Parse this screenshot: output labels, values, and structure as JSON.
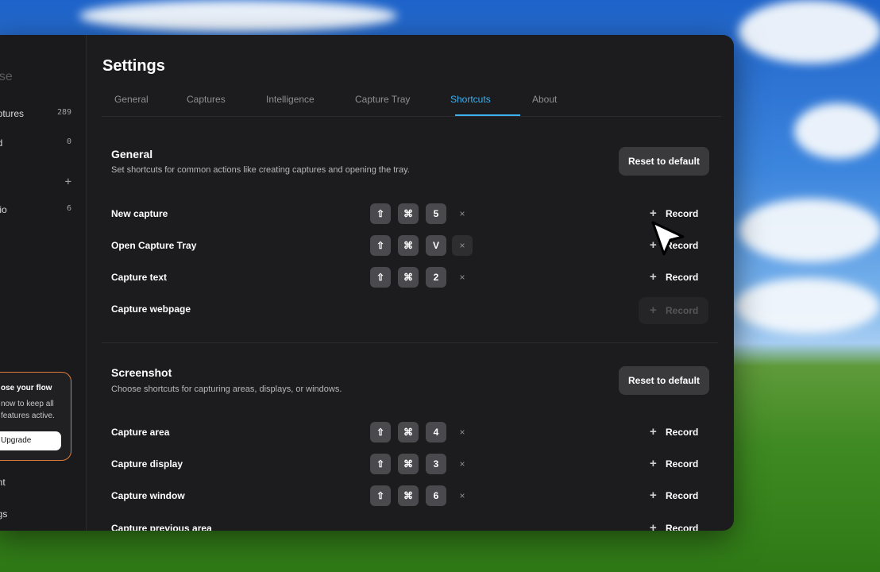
{
  "sidebar": {
    "title": "ase",
    "items": [
      {
        "label": "aptures",
        "count": "289"
      },
      {
        "label": "ed",
        "count": "0"
      },
      {
        "label": "",
        "count": "+"
      },
      {
        "label": "olio",
        "count": "6"
      }
    ],
    "promo": {
      "title": "ose your flow",
      "desc": "now to keep all features active.",
      "button": "Upgrade"
    },
    "bottom": [
      "unt",
      "ngs"
    ]
  },
  "settings": {
    "title": "Settings",
    "tabs": [
      "General",
      "Captures",
      "Intelligence",
      "Capture Tray",
      "Shortcuts",
      "About"
    ],
    "active_tab": "Shortcuts",
    "general": {
      "title": "General",
      "desc": "Set shortcuts for common actions like creating captures and opening the tray.",
      "reset": "Reset to default",
      "rows": [
        {
          "name": "New capture",
          "keys": [
            "⇧",
            "⌘",
            "5"
          ],
          "clear": "×",
          "record": "Record"
        },
        {
          "name": "Open Capture Tray",
          "keys": [
            "⇧",
            "⌘",
            "V"
          ],
          "clear": "×",
          "record": "Record"
        },
        {
          "name": "Capture text",
          "keys": [
            "⇧",
            "⌘",
            "2"
          ],
          "clear": "×",
          "record": "Record"
        },
        {
          "name": "Capture webpage",
          "record": "Record"
        }
      ]
    },
    "screenshot": {
      "title": "Screenshot",
      "desc": "Choose shortcuts for capturing areas, displays, or windows.",
      "reset": "Reset to default",
      "rows": [
        {
          "name": "Capture area",
          "keys": [
            "⇧",
            "⌘",
            "4"
          ],
          "clear": "×",
          "record": "Record"
        },
        {
          "name": "Capture display",
          "keys": [
            "⇧",
            "⌘",
            "3"
          ],
          "clear": "×",
          "record": "Record"
        },
        {
          "name": "Capture window",
          "keys": [
            "⇧",
            "⌘",
            "6"
          ],
          "clear": "×",
          "record": "Record"
        },
        {
          "name": "Capture previous area",
          "record": "Record"
        }
      ]
    }
  },
  "colors": {
    "accent": "#3db0ee",
    "window_bg": "#1c1c1e",
    "promo_border": "#e07a3a"
  },
  "icons": {
    "plus": "plus-icon",
    "clear": "close-icon",
    "shift": "shift-key-icon",
    "command": "command-key-icon",
    "cursor": "mouse-pointer-icon"
  }
}
